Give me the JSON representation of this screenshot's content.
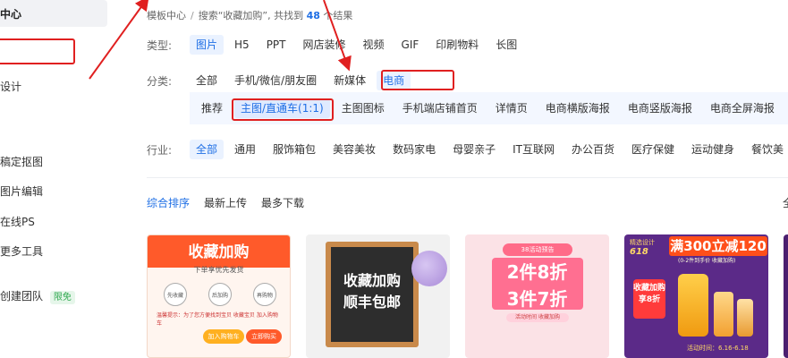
{
  "sidebar": {
    "items": [
      {
        "label": "中心"
      },
      {
        "label": "设计"
      },
      {
        "label": "稿定抠图"
      },
      {
        "label": "图片编辑"
      },
      {
        "label": "在线PS"
      },
      {
        "label": "更多工具"
      },
      {
        "label": "创建团队"
      }
    ],
    "free_badge": "限免"
  },
  "breadcrumb": {
    "home": "模板中心",
    "sep": "/",
    "search_prefix": "搜索“收藏加购”, 共找到",
    "count": "48",
    "suffix": "个结果"
  },
  "filters": {
    "type_label": "类型:",
    "types": [
      "图片",
      "H5",
      "PPT",
      "网店装修",
      "视频",
      "GIF",
      "印刷物料",
      "长图"
    ],
    "category_label": "分类:",
    "categories": [
      "全部",
      "手机/微信/朋友圈",
      "新媒体",
      "电商"
    ],
    "subcategories": [
      "推荐",
      "主图/直通车(1:1)",
      "主图图标",
      "手机端店铺首页",
      "详情页",
      "电商横版海报",
      "电商竖版海报",
      "电商全屏海报"
    ],
    "industry_label": "行业:",
    "industries": [
      "全部",
      "通用",
      "服饰箱包",
      "美容美妆",
      "数码家电",
      "母婴亲子",
      "IT互联网",
      "办公百货",
      "医疗保健",
      "运动健身",
      "餐饮美"
    ]
  },
  "sort": {
    "options": [
      "综合排序",
      "最新上传",
      "最多下载"
    ],
    "edge": "全"
  },
  "cards": {
    "c1": {
      "title": "收藏加购",
      "sub": "下单享优先发货",
      "steps": [
        "先收藏",
        "后加购",
        "再购物"
      ],
      "note": "温馨提示：为了您方便找到宝贝 收藏宝贝 加入购物车",
      "btn1": "加入购物车",
      "btn2": "立即购买"
    },
    "c2": {
      "line1": "收藏加购",
      "line2": "顺丰包邮"
    },
    "c3": {
      "tag": "38活动预告",
      "line1": "2件8折",
      "line2": "3件7折",
      "foot": "活动时间 收藏加购"
    },
    "c4": {
      "badge": "精选设计",
      "promo": "618",
      "sale": "满300立减120",
      "sub": "(0-2件到手价 收藏加购)",
      "gift": "收藏加购享8折",
      "date": "活动时间：6.16-6.18"
    }
  },
  "colors": {
    "accent": "#1f6fe5",
    "annotation_red": "#e02020"
  }
}
